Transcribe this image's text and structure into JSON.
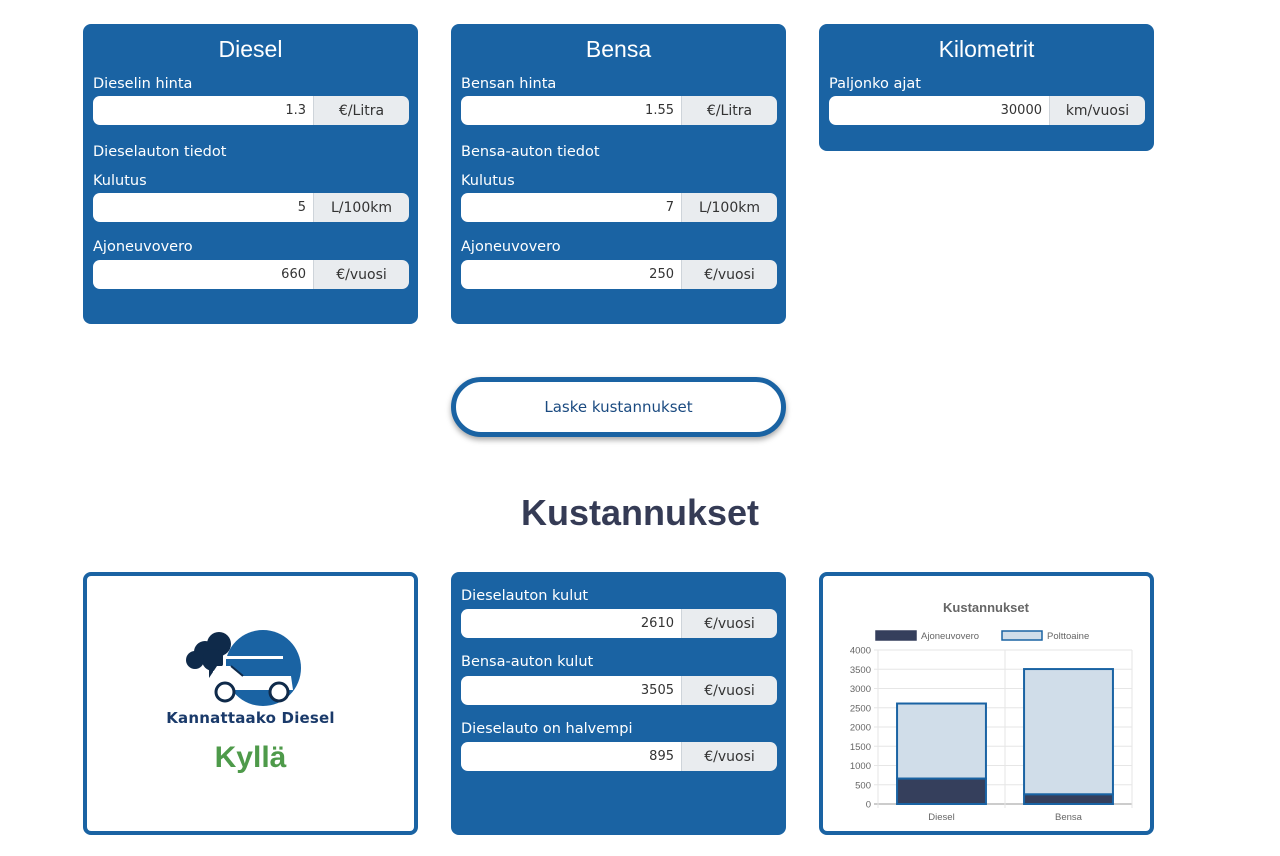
{
  "diesel": {
    "title": "Diesel",
    "price_label": "Dieselin hinta",
    "price_value": "1.3",
    "price_unit": "€/Litra",
    "info_heading": "Dieselauton tiedot",
    "consumption_label": "Kulutus",
    "consumption_value": "5",
    "consumption_unit": "L/100km",
    "tax_label": "Ajoneuvovero",
    "tax_value": "660",
    "tax_unit": "€/vuosi"
  },
  "petrol": {
    "title": "Bensa",
    "price_label": "Bensan hinta",
    "price_value": "1.55",
    "price_unit": "€/Litra",
    "info_heading": "Bensa-auton tiedot",
    "consumption_label": "Kulutus",
    "consumption_value": "7",
    "consumption_unit": "L/100km",
    "tax_label": "Ajoneuvovero",
    "tax_value": "250",
    "tax_unit": "€/vuosi"
  },
  "km": {
    "title": "Kilometrit",
    "label": "Paljonko ajat",
    "value": "30000",
    "unit": "km/vuosi"
  },
  "calculate_button": "Laske kustannukset",
  "results": {
    "title": "Kustannukset",
    "logo_text": "Kannattaako Diesel",
    "verdict": "Kyllä",
    "diesel_cost_label": "Dieselauton kulut",
    "diesel_cost_value": "2610",
    "petrol_cost_label": "Bensa-auton kulut",
    "petrol_cost_value": "3505",
    "cheaper_label": "Dieselauto on halvempi",
    "cheaper_value": "895",
    "unit": "€/vuosi"
  },
  "colors": {
    "primary": "#1a63a3",
    "verdict": "#4e9a4a",
    "tax_bar": "#353f5c",
    "fuel_bar": "#d0dde9",
    "bar_border": "#1a63a3"
  },
  "chart_data": {
    "type": "bar",
    "stacked": true,
    "title": "Kustannukset",
    "categories": [
      "Diesel",
      "Bensa"
    ],
    "series": [
      {
        "name": "Ajoneuvovero",
        "values": [
          660,
          250
        ]
      },
      {
        "name": "Polttoaine",
        "values": [
          1950,
          3255
        ]
      }
    ],
    "ylim": [
      0,
      4000
    ],
    "yticks": [
      0,
      500,
      1000,
      1500,
      2000,
      2500,
      3000,
      3500,
      4000
    ],
    "legend": "top",
    "grid": true
  }
}
